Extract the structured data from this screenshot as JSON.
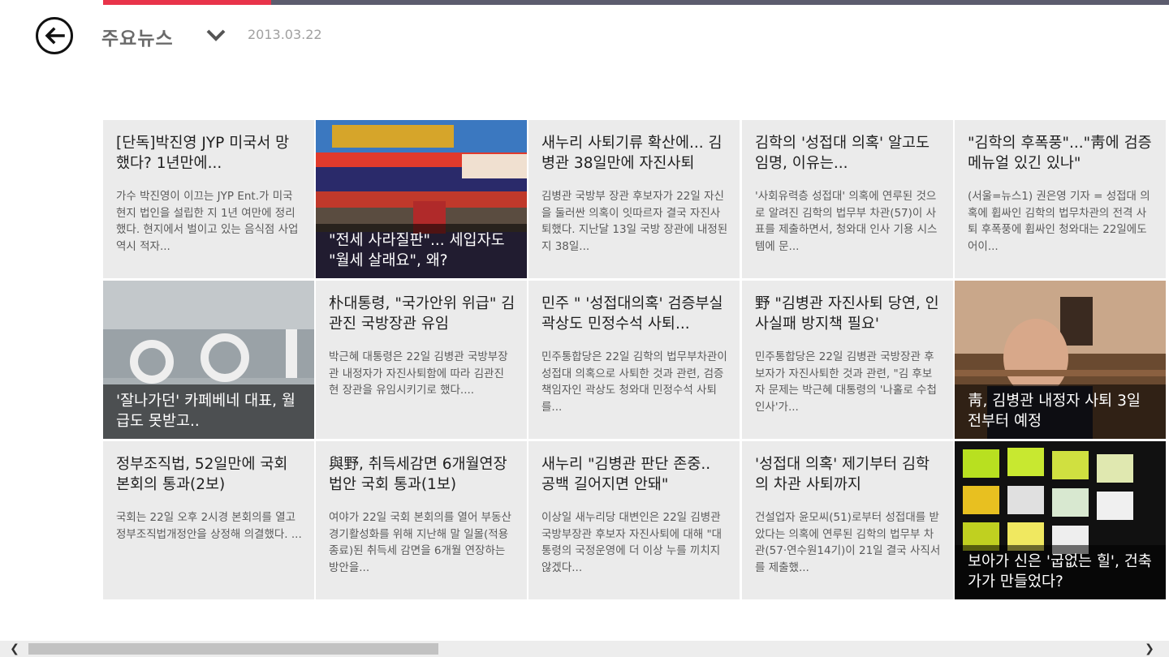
{
  "header": {
    "title": "주요뉴스",
    "date": "2013.03.22"
  },
  "colors": {
    "accent": "#e8334a",
    "progress_track": "#5c5c6e",
    "tile_bg": "#ebebeb"
  },
  "tiles": [
    {
      "headline": "[단독]박진영 JYP 미국서 망했다? 1년만에...",
      "summary": "가수 박진영이 이끄는 JYP Ent.가 미국 현지 법인을 설립한 지 1년 여만에 정리했다. 현지에서 벌이고 있는 음식점 사업 역시 적자..."
    },
    {
      "caption": "\"전세 사라질판\"... 세입자도 \"월세 살래요\", 왜?",
      "image": "real-estate-storefront-photo"
    },
    {
      "headline": "새누리 사퇴기류 확산에... 김병관 38일만에 자진사퇴",
      "summary": "김병관 국방부 장관 후보자가 22일 자신을 둘러싼 의혹이 잇따르자 결국 자진사퇴했다. 지난달 13일 국방 장관에 내정된 지 38일..."
    },
    {
      "headline": "김학의 '성접대 의혹' 알고도 임명, 이유는...",
      "summary": "'사회유력층 성접대' 의혹에 연루된 것으로 알려진 김학의 법무부 차관(57)이 사표를 제출하면서, 청와대 인사 기용 시스템에 문..."
    },
    {
      "headline": "\"김학의 후폭풍\"...\"靑에 검증메뉴얼 있긴 있나\"",
      "summary": "(서울=뉴스1) 권은영 기자 = 성접대 의혹에 휩싸인 김학의 법무차관의 전격 사퇴 후폭풍에 휩싸인 청와대는 22일에도 어이..."
    },
    {
      "caption": "'잘나가던' 카페베네 대표, 월급도 못받고..",
      "image": "cafe-sign-photo"
    },
    {
      "headline": "朴대통령, \"국가안위 위급\" 김관진 국방장관 유임",
      "summary": "박근혜 대통령은 22일 김병관 국방부장관 내정자가 자진사퇴함에 따라 김관진 현 장관을 유임시키기로 했다...."
    },
    {
      "headline": "민주 \" '성접대의혹' 검증부실 곽상도 민정수석 사퇴...",
      "summary": "민주통합당은 22일 김학의 법무부차관이 성접대 의혹으로 사퇴한 것과 관련, 검증 책임자인 곽상도 청와대 민정수석 사퇴를..."
    },
    {
      "headline": "野 \"김병관 자진사퇴 당연, 인사실패 방지책 필요'",
      "summary": "민주통합당은 22일 김병관 국방장관 후보자가 자진사퇴한 것과 관련, \"김 후보자 문제는 박근혜 대통령의 '나홀로 수첩인사'가..."
    },
    {
      "caption": "靑, 김병관 내정자 사퇴 3일 전부터 예정",
      "image": "hearing-room-photo"
    },
    {
      "headline": "정부조직법, 52일만에 국회 본회의 통과(2보)",
      "summary": "국회는 22일 오후 2시경 본회의를 열고 정부조직법개정안을 상정해 의결했다. ..."
    },
    {
      "headline": "與野, 취득세감면 6개월연장 법안 국회 통과(1보)",
      "summary": "여야가 22일 국회 본회의를 열어 부동산 경기활성화를 위해 지난해 말 일몰(적용종료)된 취득세 감면을 6개월 연장하는 방안을..."
    },
    {
      "headline": "새누리 \"김병관 판단 존중.. 공백 길어지면 안돼\"",
      "summary": "이상일 새누리당 대변인은 22일 김병관 국방부장관 후보자 자진사퇴에 대해 \"대통령의 국정운영에 더 이상 누를 끼치지 않겠다..."
    },
    {
      "headline": "'성접대 의혹' 제기부터 김학의 차관 사퇴까지",
      "summary": "건설업자 윤모씨(51)로부터 성접대를 받았다는 의혹에 연루된 김학의 법무부 차관(57·연수원14기)이 21일 결국 사직서를 제출했..."
    },
    {
      "caption": "보아가 신은 '굽없는 힐', 건축가가 만들었다?",
      "image": "shoe-display-photo"
    }
  ],
  "scroll": {
    "position_fraction": 0.0,
    "visible_fraction": 0.36
  }
}
